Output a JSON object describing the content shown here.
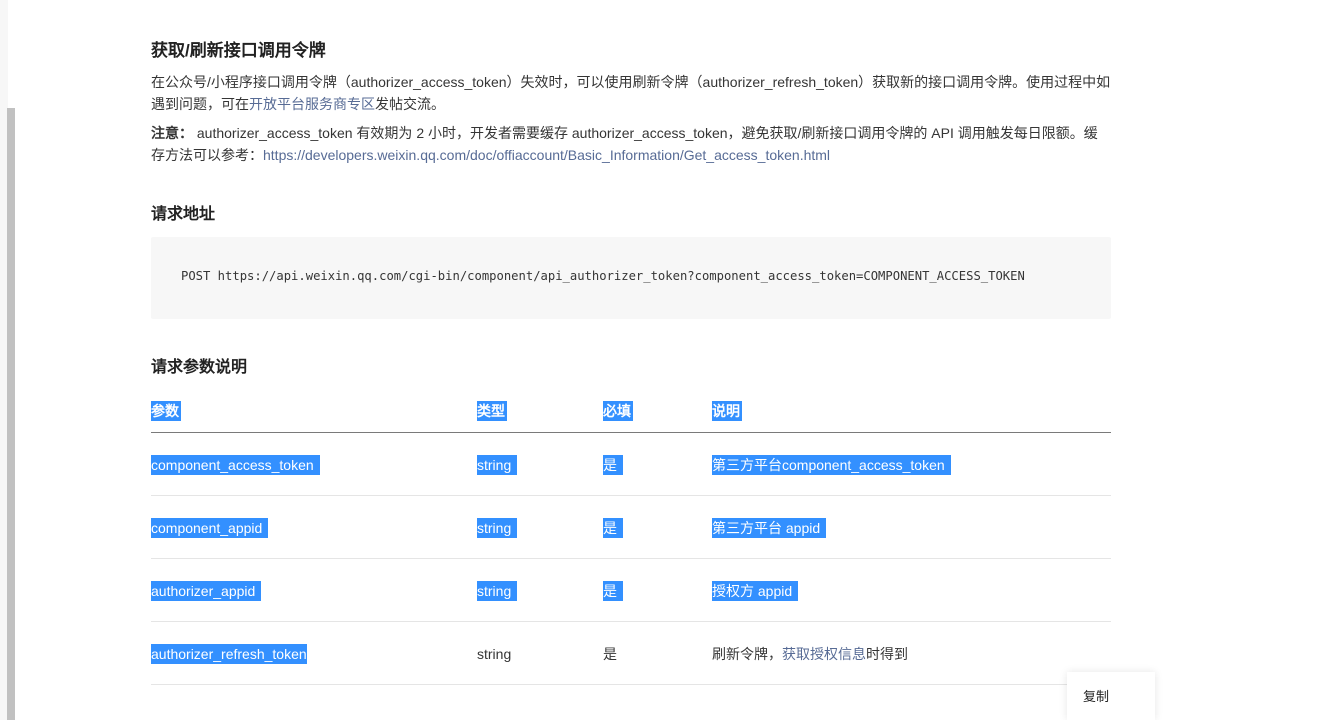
{
  "section": {
    "title": "获取/刷新接口调用令牌",
    "intro_before": "在公众号/小程序接口调用令牌（authorizer_access_token）失效时，可以使用刷新令牌（authorizer_refresh_token）获取新的接口调用令牌。使用过程中如遇到问题，可在",
    "intro_link": "开放平台服务商专区",
    "intro_after": "发帖交流。",
    "note_label": "注意：",
    "note_text": " authorizer_access_token 有效期为 2 小时，开发者需要缓存 authorizer_access_token，避免获取/刷新接口调用令牌的 API 调用触发每日限额。缓存方法可以参考：",
    "note_link": "https://developers.weixin.qq.com/doc/offiaccount/Basic_Information/Get_access_token.html"
  },
  "request_url": {
    "title": "请求地址",
    "code": "POST https://api.weixin.qq.com/cgi-bin/component/api_authorizer_token?component_access_token=COMPONENT_ACCESS_TOKEN"
  },
  "params": {
    "title": "请求参数说明",
    "headers": [
      "参数",
      "类型",
      "必填",
      "说明"
    ],
    "rows": [
      {
        "name": "component_access_token",
        "type": "string",
        "required": "是",
        "desc": "第三方平台component_access_token"
      },
      {
        "name": "component_appid",
        "type": "string",
        "required": "是",
        "desc": "第三方平台 appid"
      },
      {
        "name": "authorizer_appid",
        "type": "string",
        "required": "是",
        "desc": "授权方 appid"
      },
      {
        "name": "authorizer_refresh_token",
        "type": "string",
        "required": "是",
        "desc_before": "刷新令牌，",
        "desc_link": "获取授权信息",
        "desc_after": "时得到"
      }
    ]
  },
  "copy_popup": {
    "label": "复制"
  },
  "colors": {
    "selection": "#3390ff",
    "link": "#576b95",
    "code_bg": "#f7f7f7"
  }
}
